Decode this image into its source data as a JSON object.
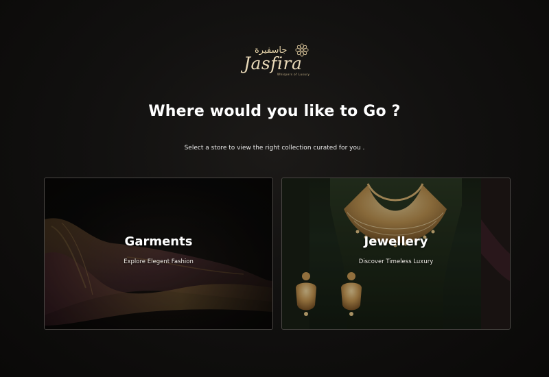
{
  "brand": {
    "name": "Jasfira",
    "arabic_name": "جاسفيرة",
    "tagline": "Whispers of Luxury",
    "logo_icon": "flower-icon",
    "accent_color": "#d9c49a"
  },
  "hero": {
    "title": "Where would you like to Go ?",
    "subtitle": "Select a store to view the right collection curated for you ."
  },
  "stores": [
    {
      "title": "Garments",
      "subtitle": "Explore Elegent Fashion",
      "image": "draped-silk-fabric"
    },
    {
      "title": "Jewellery",
      "subtitle": "Discover Timeless Luxury",
      "image": "gold-necklace-and-earrings"
    }
  ]
}
